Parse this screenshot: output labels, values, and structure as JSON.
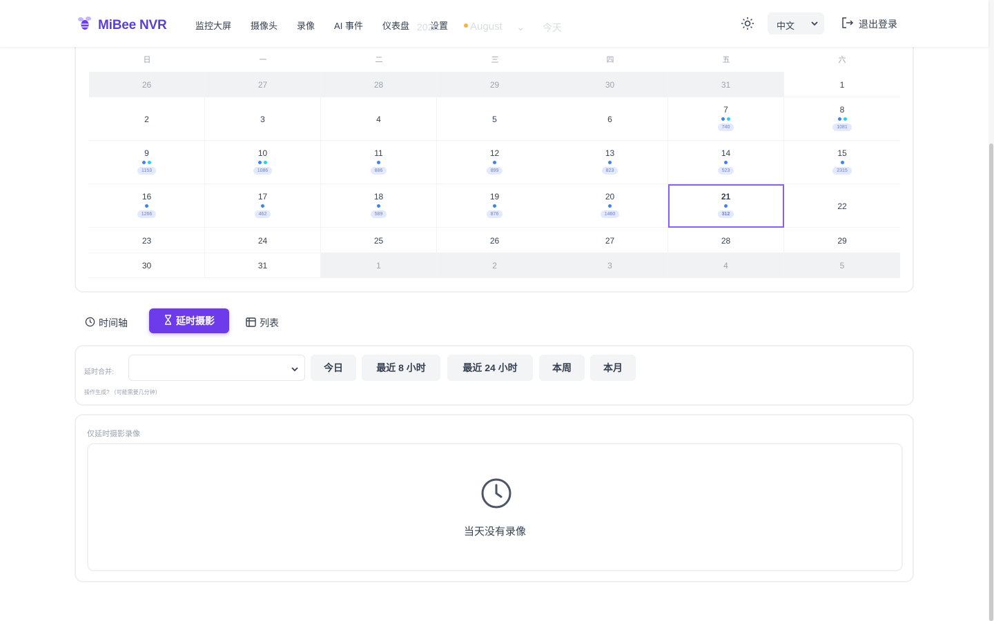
{
  "header": {
    "app_title": "MiBee NVR",
    "nav": [
      "监控大屏",
      "摄像头",
      "录像",
      "AI 事件",
      "仪表盘",
      "设置"
    ],
    "ghost_year": "2026",
    "ghost_month": "August",
    "ghost_today": "今天",
    "language": "中文",
    "logout": "退出登录"
  },
  "calendar": {
    "weekdays": [
      "日",
      "一",
      "二",
      "三",
      "四",
      "五",
      "六"
    ],
    "rows": [
      [
        {
          "day": "26",
          "muted": true
        },
        {
          "day": "27",
          "muted": true
        },
        {
          "day": "28",
          "muted": true
        },
        {
          "day": "29",
          "muted": true
        },
        {
          "day": "30",
          "muted": true
        },
        {
          "day": "31",
          "muted": true
        },
        {
          "day": "1"
        }
      ],
      [
        {
          "day": "2"
        },
        {
          "day": "3"
        },
        {
          "day": "4"
        },
        {
          "day": "5"
        },
        {
          "day": "6"
        },
        {
          "day": "7",
          "dots": [
            "blue",
            "teal"
          ],
          "count": "740"
        },
        {
          "day": "8",
          "dots": [
            "blue",
            "teal"
          ],
          "count": "1081"
        }
      ],
      [
        {
          "day": "9",
          "dots": [
            "blue",
            "teal"
          ],
          "count": "1153"
        },
        {
          "day": "10",
          "dots": [
            "blue",
            "teal"
          ],
          "count": "1086"
        },
        {
          "day": "11",
          "dots": [
            "blue"
          ],
          "count": "886"
        },
        {
          "day": "12",
          "dots": [
            "blue"
          ],
          "count": "899"
        },
        {
          "day": "13",
          "dots": [
            "blue"
          ],
          "count": "823"
        },
        {
          "day": "14",
          "dots": [
            "blue"
          ],
          "count": "523"
        },
        {
          "day": "15",
          "dots": [
            "blue"
          ],
          "count": "2315"
        }
      ],
      [
        {
          "day": "16",
          "dots": [
            "blue"
          ],
          "count": "1266"
        },
        {
          "day": "17",
          "dots": [
            "blue"
          ],
          "count": "462"
        },
        {
          "day": "18",
          "dots": [
            "blue"
          ],
          "count": "589"
        },
        {
          "day": "19",
          "dots": [
            "blue"
          ],
          "count": "876"
        },
        {
          "day": "20",
          "dots": [
            "blue"
          ],
          "count": "1460"
        },
        {
          "day": "21",
          "dots": [
            "blue"
          ],
          "count": "312",
          "today": true
        },
        {
          "day": "22"
        }
      ],
      [
        {
          "day": "23"
        },
        {
          "day": "24"
        },
        {
          "day": "25"
        },
        {
          "day": "26"
        },
        {
          "day": "27"
        },
        {
          "day": "28"
        },
        {
          "day": "29"
        }
      ],
      [
        {
          "day": "30"
        },
        {
          "day": "31"
        },
        {
          "day": "1",
          "muted": true
        },
        {
          "day": "2",
          "muted": true
        },
        {
          "day": "3",
          "muted": true
        },
        {
          "day": "4",
          "muted": true
        },
        {
          "day": "5",
          "muted": true
        }
      ]
    ]
  },
  "tabs": {
    "timeline": "时间轴",
    "timelapse": "延时摄影",
    "list": "列表"
  },
  "filter": {
    "label": "延时合并:",
    "select_value": "",
    "hint": "操作生成? （可能需要几分钟）",
    "quick": [
      "今日",
      "最近 8 小时",
      "最近 24 小时",
      "本周",
      "本月"
    ]
  },
  "recordings": {
    "title": "仅延时摄影录像",
    "empty": "当天没有录像"
  },
  "colors": {
    "accent": "#6d3bea",
    "brand": "#5b3fd6",
    "today_border": "#8b5cf6",
    "dot_blue": "#3b82f6",
    "dot_teal": "#22d3ee"
  }
}
